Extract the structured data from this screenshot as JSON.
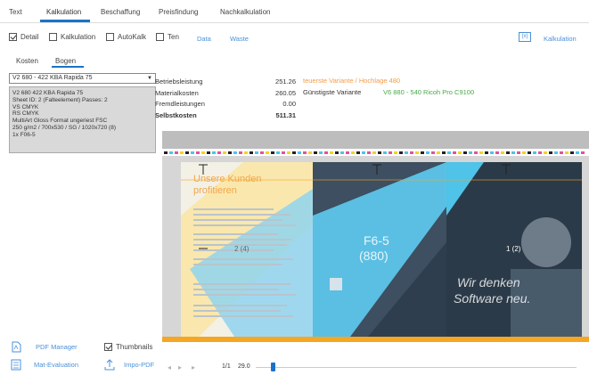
{
  "menu": {
    "items": [
      "Text",
      "Kalkulation",
      "Beschaffung",
      "Preisfindung",
      "Nachkalkulation"
    ]
  },
  "options": {
    "detail": {
      "label": "Detail",
      "checked": true
    },
    "kalkulation": {
      "label": "Kalkulation",
      "checked": false
    },
    "autokalk": {
      "label": "AutoKalk",
      "checked": false
    },
    "ten": {
      "label": "Ten",
      "checked": false
    },
    "data_link": "Data",
    "waste_link": "Waste",
    "right_icon_label": "{x}",
    "right_link": "Kalkulation"
  },
  "left": {
    "tabs": [
      "Kosten",
      "Bogen"
    ],
    "select_value": "V2 680 - 422 KBA Rapida 75",
    "info_lines": [
      "V2 680 422 KBA Rapida 75",
      "Sheet ID: 2 (Falteelement) Passes: 2",
      "VS CMYK",
      "RS CMYK",
      "MultiArt Gloss Format ungeriest FSC",
      "250 g/m2 / 700x530 / SG / 1020x720 (8)",
      "1x F06-5"
    ]
  },
  "summary": {
    "rows": [
      {
        "label": "Betriebsleistung",
        "value": "251.26",
        "bold": false
      },
      {
        "label": "Materialkosten",
        "value": "260.05",
        "bold": false
      },
      {
        "label": "Fremdleistungen",
        "value": "0.00",
        "bold": false
      },
      {
        "label": "Selbstkosten",
        "value": "511.31",
        "bold": true
      }
    ],
    "orange_note": "teuerste Variante / Hochlage 480",
    "cheapest_label": "Günstigste Variante",
    "cheapest_value": "V6 880 - 540 Ricoh Pro C9100"
  },
  "preview": {
    "heading_line1": "Unsere Kunden",
    "heading_line2": "profitieren",
    "fold_label": "F6-5",
    "fold_sub": "(880)",
    "page_left": "2 (4)",
    "page_right": "1 (2)",
    "slogan_line1": "Wir denken",
    "slogan_line2": "Software neu."
  },
  "status": {
    "page": "1/1",
    "zoom": "29.0"
  },
  "bottom": {
    "pdf_manager": "PDF Manager",
    "thumbnails": "Thumbnails",
    "mat_evaluation": "Mat-Evaluation",
    "impo_pdf": "Impo-PDF"
  },
  "colors": {
    "accent": "#1a73c8",
    "link": "#4a90d9",
    "orange": "#f5a623",
    "green": "#4aa84a",
    "cyan": "#4fc3e8",
    "dark_teal": "#2e3e4e"
  }
}
